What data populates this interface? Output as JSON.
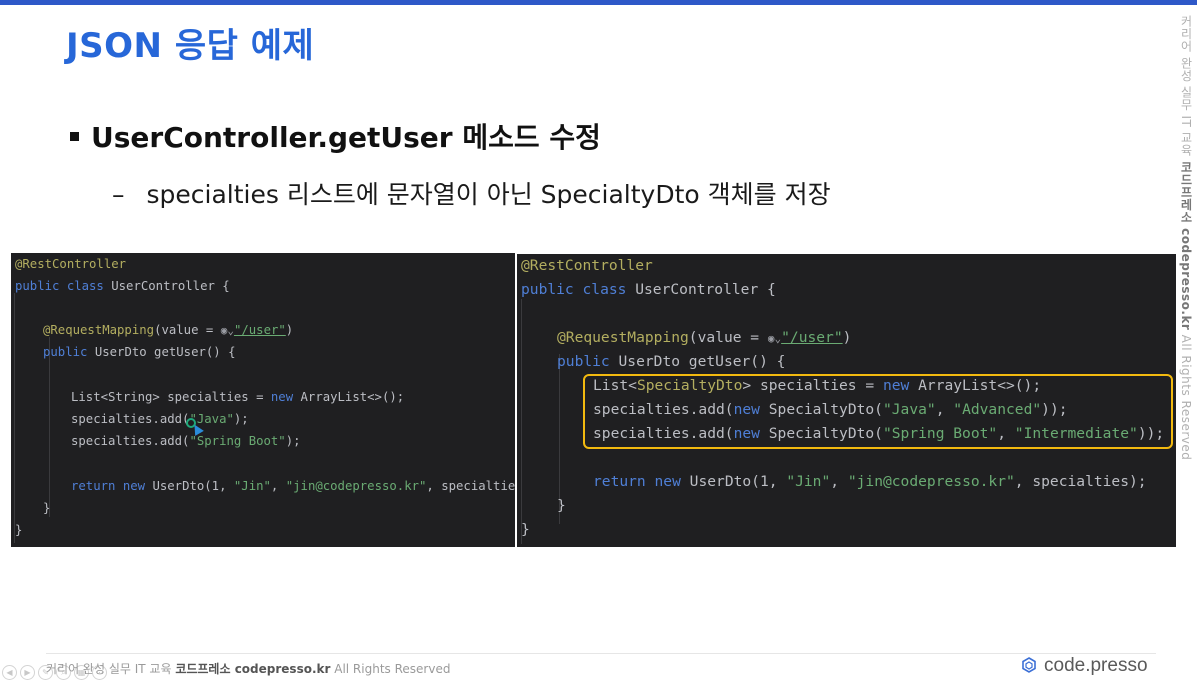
{
  "slide": {
    "title": "JSON 응답 예제",
    "bullet": "UserController.getUser 메소드 수정",
    "sub_bullet": "specialties 리스트에 문자열이 아닌 SpecialtyDto 객체를 저장"
  },
  "side_watermark": {
    "prefix": "커리어 완성 실무 IT 교육 ",
    "brand": "코드프레소 codepresso.kr",
    "suffix": " All Rights Reserved"
  },
  "footer": {
    "prefix": "커리어 완성 실무 IT 교육 ",
    "brand": "코드프레소 codepresso.kr",
    "suffix": " All Rights Reserved",
    "logo": "code.presso"
  },
  "code_before": {
    "l1": "@RestController",
    "l2a": "public class ",
    "l2b": "UserController {",
    "l3a": "@RequestMapping",
    "l3b": "(value = ",
    "l3c": "\"/user\"",
    "l3d": ")",
    "l4a": "public ",
    "l4b": "UserDto getUser() {",
    "l5a": "List<String> specialties = ",
    "l5b": "new ",
    "l5c": "ArrayList<>();",
    "l6a": "specialties.add(",
    "l6b": "\"Java\"",
    "l6c": ");",
    "l7a": "specialties.add(",
    "l7b": "\"Spring Boot\"",
    "l7c": ");",
    "l8a": "return ",
    "l8b": "new ",
    "l8c": "UserDto(1, ",
    "l8d": "\"Jin\"",
    "l8e": ", ",
    "l8f": "\"jin@codepresso.kr\"",
    "l8g": ", specialties);",
    "l9": "}",
    "l10": "}"
  },
  "code_after": {
    "l1": "@RestController",
    "l2a": "public class ",
    "l2b": "UserController {",
    "l3a": "@RequestMapping",
    "l3b": "(value = ",
    "l3c": "\"/user\"",
    "l3d": ")",
    "l4a": "public ",
    "l4b": "UserDto getUser() {",
    "l5a": "List<",
    "l5b": "SpecialtyDto",
    "l5c": "> specialties = ",
    "l5d": "new ",
    "l5e": "ArrayList<>();",
    "l6a": "specialties.add(",
    "l6b": "new ",
    "l6c": "SpecialtyDto(",
    "l6d": "\"Java\"",
    "l6e": ", ",
    "l6f": "\"Advanced\"",
    "l6g": "));",
    "l7a": "specialties.add(",
    "l7b": "new ",
    "l7c": "SpecialtyDto(",
    "l7d": "\"Spring Boot\"",
    "l7e": ", ",
    "l7f": "\"Intermediate\"",
    "l7g": "));",
    "l8a": "return ",
    "l8b": "new ",
    "l8c": "UserDto(1, ",
    "l8d": "\"Jin\"",
    "l8e": ", ",
    "l8f": "\"jin@codepresso.kr\"",
    "l8g": ", specialties);",
    "l9": "}",
    "l10": "}"
  },
  "colors": {
    "title": "#2767d8",
    "top_bar": "#2e58c8",
    "highlight_box": "#f2b90f",
    "code_bg": "#1f1f21"
  }
}
